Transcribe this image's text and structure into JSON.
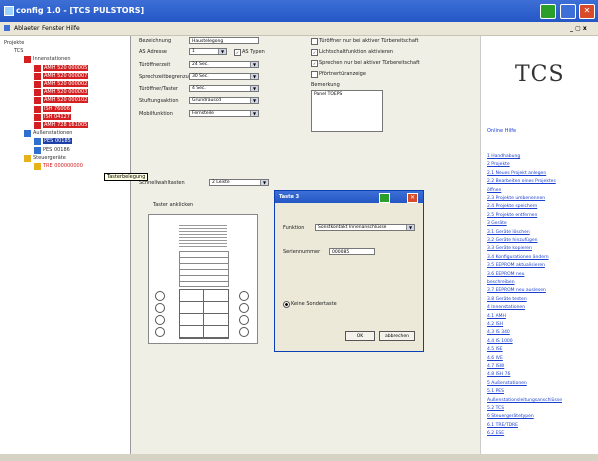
{
  "window": {
    "title": "config 1.0 - [TCS PULSTORS]",
    "close_glyph": "✕"
  },
  "menu": {
    "items": [
      "Ablaeter",
      "Fenster",
      "Hilfe"
    ],
    "mdi_controls": "_ ▢ x"
  },
  "tree": {
    "nodes": [
      {
        "label": "Projekte",
        "level": 0,
        "icon": ""
      },
      {
        "label": "TCS",
        "level": 1,
        "icon": ""
      },
      {
        "label": "Innenstationen",
        "level": 2,
        "icon": "red"
      },
      {
        "label": "AMH 520 000005",
        "level": 3,
        "icon": "red"
      },
      {
        "label": "AMH 520 000007",
        "level": 3,
        "icon": "red"
      },
      {
        "label": "AMH 520 000002",
        "level": 3,
        "icon": "red"
      },
      {
        "label": "AMH 520 000003",
        "level": 3,
        "icon": "red"
      },
      {
        "label": "AMH 520 000102",
        "level": 3,
        "icon": "red"
      },
      {
        "label": "ISH 76006",
        "level": 3,
        "icon": "red"
      },
      {
        "label": "ISH 04127",
        "level": 3,
        "icon": "red"
      },
      {
        "label": "AMH 728 161005",
        "level": 3,
        "icon": "red"
      },
      {
        "label": "Außenstationen",
        "level": 2,
        "icon": "blue"
      },
      {
        "label": "PES 00185",
        "level": 3,
        "icon": "blue",
        "selected": true
      },
      {
        "label": "PES 00186",
        "level": 3,
        "icon": "blue"
      },
      {
        "label": "Steuergeräte",
        "level": 2,
        "icon": "yellow"
      },
      {
        "label": "TRE 000000000",
        "level": 3,
        "icon": "yellow"
      }
    ],
    "tooltip": "Tasterbelegung"
  },
  "form": {
    "bezeichnung": {
      "label": "Bezeichnung",
      "value": "Haustelegong"
    },
    "as_adresse": {
      "label": "AS Adresse",
      "value": "1",
      "checkbox_label": "AS Typen",
      "checkbox_checked": true
    },
    "tuerpause": {
      "label": "Türöffnerzeit",
      "value": "24 Sec."
    },
    "sprechzeit": {
      "label": "Sprechzeitbegrenzung",
      "value": "30 Sec."
    },
    "tueroeffnerzeit": {
      "label": "Türöffner/Taster",
      "value": "4 Sec."
    },
    "stuftungsaktion": {
      "label": "Stuftungsaktion",
      "value": "Grundrauscd"
    },
    "mobilfunktion": {
      "label": "Mobilfunktion",
      "value": "Fernsteile"
    },
    "checks": [
      {
        "label": "Türöffner nur bei aktiver Türbereitschaft",
        "checked": false
      },
      {
        "label": "Lichtschaltfunktion aktivieren",
        "checked": true
      },
      {
        "label": "Sprechen nur bei aktiver Türbereitschaft",
        "checked": true
      },
      {
        "label": "Pförtnertüranzeige",
        "checked": false
      }
    ],
    "bemerkung": {
      "label": "Bemerkung",
      "value": "Panel TOEPS"
    },
    "schnellwahl": {
      "label": "Schnellwahltasten",
      "value": "2 Leiste"
    },
    "taster_label": "Taster anklicken",
    "check_glyph": "✓",
    "dropdown_glyph": "▼"
  },
  "dialog": {
    "title": "Taste 3",
    "funktion": {
      "label": "Funktion",
      "value": "Sonstkontakt Innenanschlüsse"
    },
    "seriennummer": {
      "label": "Seriennummer",
      "value": "000085"
    },
    "radio_label": "Keine Sondertaste",
    "ok_label": "OK",
    "cancel_label": "abbrechen"
  },
  "help": {
    "logo": "TCS",
    "heading": "Online Hilfe",
    "links": [
      "1 Handhabung",
      "2 Projekte",
      "2.1 Neues Projekt anlegen",
      "2.2 Bearbeiten eines Projektes",
      "öffnen",
      "2.3 Projekte umbenennen",
      "2.4 Projekte speichern",
      "2.5 Projekte entfernen",
      "3 Geräte",
      "3.1 Geräte löschen",
      "3.2 Geräte hinzufügen",
      "3.3 Geräte kopieren",
      "3.4 Konfigurationen ändern",
      "3.5 EEPROM aktualisieren",
      "3.6 EEPROM neu",
      "beschreiben",
      "3.7 EEPROM neu auslesen",
      "3.8 Geräte testen",
      "4 Innenstationen",
      "4.1 AMH",
      "4.2 ISH",
      "4.3 IS 340",
      "4.4 IS 1000",
      "4.5 ISE",
      "4.6 IVE",
      "4.7 ISW",
      "4.8 ISH 76",
      "5 Außenstationen",
      "5.1 PES",
      "Außenstationsleitungsanschlüsse",
      "5.2 TCS",
      "6 Steuergerätetypen",
      "6.1 TRE/TDRE",
      "6.2 ESE"
    ]
  },
  "colors": {
    "titlebar": "#2457c5",
    "accent_red": "#d42020",
    "accent_blue": "#2f6fd0",
    "accent_yellow": "#e6b21b",
    "link": "#1a3fcf",
    "minimize_green": "#2aa02a",
    "close_red": "#d94a2b"
  }
}
